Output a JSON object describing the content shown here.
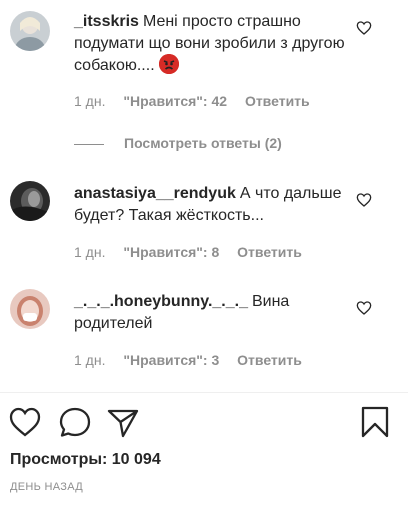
{
  "comments": [
    {
      "username": "_itsskris",
      "text": "Мені просто страшно подумати що вони зробили з другою собакою....",
      "emoji": "angry-face-emoji",
      "time": "1 дн.",
      "likes": "\"Нравится\": 42",
      "reply": "Ответить"
    },
    {
      "username": "anastasiya__rendyuk",
      "text": "А что дальше будет? Такая жёсткость...",
      "time": "1 дн.",
      "likes": "\"Нравится\": 8",
      "reply": "Ответить"
    },
    {
      "username": "_._._.honeybunny._._._",
      "text": "Вина родителей",
      "time": "1 дн.",
      "likes": "\"Нравится\": 3",
      "reply": "Ответить"
    }
  ],
  "view_replies": "Посмотреть ответы (2)",
  "actions": {
    "like_icon": "heart-icon",
    "comment_icon": "comment-icon",
    "share_icon": "share-icon",
    "save_icon": "bookmark-icon"
  },
  "views": "Просмотры: 10 094",
  "date": "ДЕНЬ НАЗАД",
  "colors": {
    "text": "#262626",
    "secondary": "#8e8e8e",
    "emoji": "#d62b26"
  }
}
